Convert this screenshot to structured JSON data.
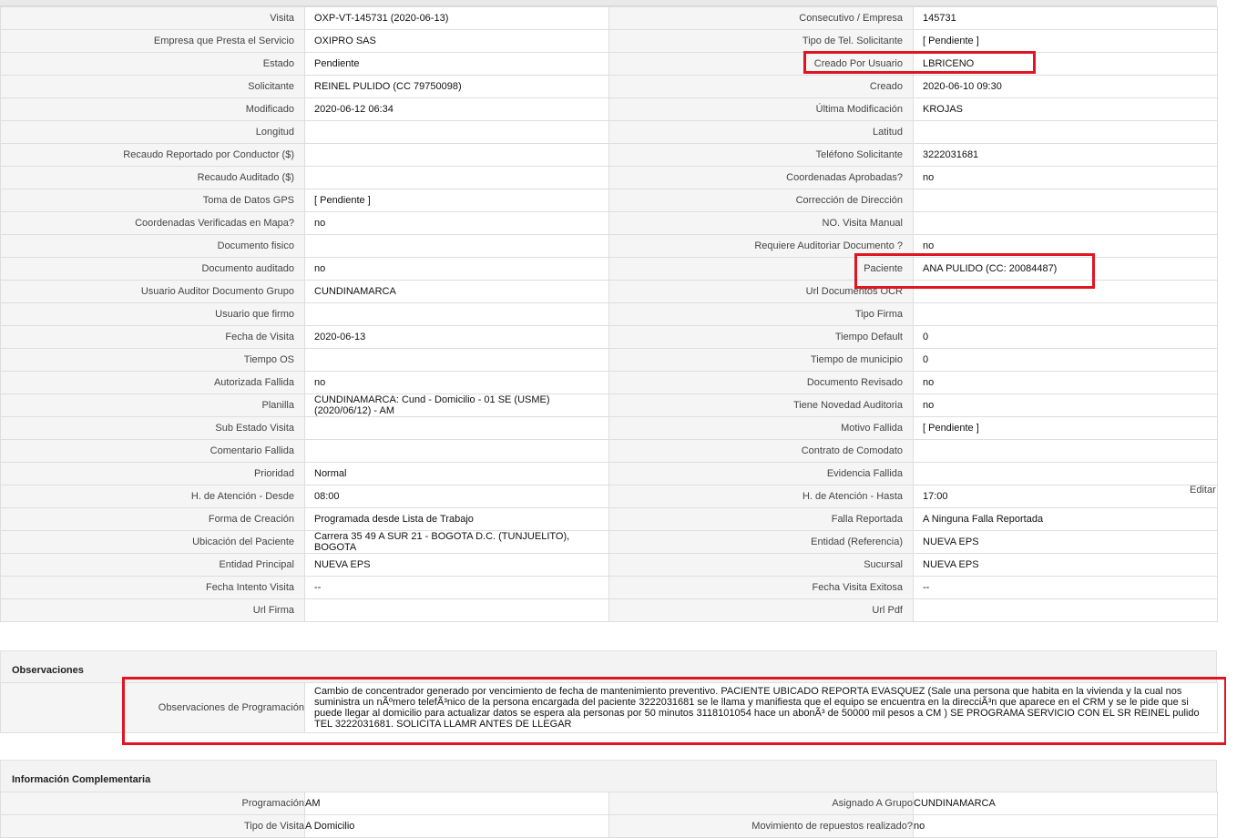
{
  "details": {
    "rows": [
      {
        "l1": "Visita",
        "v1": "OXP-VT-145731 (2020-06-13)",
        "l2": "Consecutivo / Empresa",
        "v2": "145731"
      },
      {
        "l1": "Empresa que Presta el Servicio",
        "v1": "OXIPRO SAS",
        "l2": "Tipo de Tel. Solicitante",
        "v2": "[ Pendiente ]"
      },
      {
        "l1": "Estado",
        "v1": "Pendiente",
        "l2": "Creado Por Usuario",
        "v2": "LBRICENO"
      },
      {
        "l1": "Solicitante",
        "v1": "REINEL PULIDO (CC 79750098)",
        "l2": "Creado",
        "v2": "2020-06-10 09:30"
      },
      {
        "l1": "Modificado",
        "v1": "2020-06-12 06:34",
        "l2": "Última Modificación",
        "v2": " KROJAS"
      },
      {
        "l1": "Longitud",
        "v1": "",
        "l2": "Latitud",
        "v2": ""
      },
      {
        "l1": "Recaudo Reportado por Conductor ($)",
        "v1": "",
        "l2": "Teléfono Solicitante",
        "v2": "3222031681"
      },
      {
        "l1": "Recaudo Auditado ($)",
        "v1": "",
        "l2": "Coordenadas Aprobadas?",
        "v2": " no"
      },
      {
        "l1": "Toma de Datos GPS",
        "v1": "[ Pendiente ]",
        "l2": "Corrección de Dirección",
        "v2": ""
      },
      {
        "l1": "Coordenadas Verificadas en Mapa?",
        "v1": " no",
        "l2": "NO. Visita Manual",
        "v2": ""
      },
      {
        "l1": "Documento fisico",
        "v1": "",
        "l2": "Requiere Auditoriar Documento ?",
        "v2": " no"
      },
      {
        "l1": "Documento auditado",
        "v1": " no",
        "l2": "Paciente",
        "v2": "ANA PULIDO (CC: 20084487)"
      },
      {
        "l1": "Usuario Auditor Documento Grupo",
        "v1": "CUNDINAMARCA",
        "l2": "Url Documentos OCR",
        "v2": ""
      },
      {
        "l1": "Usuario que firmo",
        "v1": "",
        "l2": "Tipo Firma",
        "v2": ""
      },
      {
        "l1": "Fecha de Visita",
        "v1": " 2020-06-13",
        "l2": "Tiempo Default",
        "v2": "0"
      },
      {
        "l1": "Tiempo OS",
        "v1": "",
        "l2": "Tiempo de municipio",
        "v2": "0"
      },
      {
        "l1": "Autorizada Fallida",
        "v1": " no",
        "l2": "Documento Revisado",
        "v2": " no"
      },
      {
        "l1": "Planilla",
        "v1": "CUNDINAMARCA: Cund - Domicilio - 01 SE (USME) (2020/06/12) - AM",
        "l2": "Tiene Novedad Auditoria",
        "v2": " no"
      },
      {
        "l1": "Sub Estado Visita",
        "v1": "",
        "l2": "Motivo Fallida",
        "v2": "[ Pendiente ]"
      },
      {
        "l1": "Comentario Fallida",
        "v1": "",
        "l2": "Contrato de Comodato",
        "v2": ""
      },
      {
        "l1": "Prioridad",
        "v1": "Normal",
        "l2": "Evidencia Fallida",
        "v2": ""
      },
      {
        "l1": "H. de Atención - Desde",
        "v1": "08:00",
        "l2": "H. de Atención - Hasta",
        "v2": "17:00"
      },
      {
        "l1": "Forma de Creación",
        "v1": "Programada desde Lista de Trabajo",
        "l2": "Falla Reportada",
        "v2": "A Ninguna Falla Reportada"
      },
      {
        "l1": "Ubicación del Paciente",
        "v1": "Carrera 35 49 A SUR 21 - BOGOTA D.C. (TUNJUELITO), BOGOTA",
        "l2": "Entidad (Referencia)",
        "v2": "NUEVA EPS"
      },
      {
        "l1": "Entidad Principal",
        "v1": "NUEVA EPS",
        "l2": "Sucursal",
        "v2": "NUEVA EPS"
      },
      {
        "l1": "Fecha Intento Visita",
        "v1": " --",
        "l2": "Fecha Visita Exitosa",
        "v2": " --"
      },
      {
        "l1": "Url Firma",
        "v1": "",
        "l2": "Url Pdf",
        "v2": ""
      }
    ],
    "edit_label": "Editar"
  },
  "observaciones": {
    "title": "Observaciones",
    "label": "Observaciones de Programación",
    "text": "   Cambio de concentrador generado por vencimiento de fecha de mantenimiento preventivo. PACIENTE UBICADO REPORTA EVASQUEZ (Sale una persona que habita en la vivienda y la cual nos suministra un nÃºmero telefÃ³nico de la persona encargada del paciente 3222031681 se le llama y manifiesta que el equipo se encuentra en la direcciÃ³n que aparece en el CRM y se le pide que si puede llegar al domicilio para actualizar datos se espera ala personas por 50 minutos 3118101054 hace un abonÃ³ de 50000 mil pesos a CM ) SE PROGRAMA SERVICIO CON EL SR REINEL pulido TEL 3222031681. SOLICITA LLAMR ANTES DE LLEGAR"
  },
  "info_complementaria": {
    "title": "Información Complementaria",
    "rows": [
      {
        "l1": "Programación",
        "v1": "AM",
        "l2": "Asignado A Grupo",
        "v2": "CUNDINAMARCA"
      },
      {
        "l1": "Tipo de Visita",
        "v1": "A Domicilio",
        "l2": "Movimiento de repuestos realizado?",
        "v2": " no"
      }
    ]
  },
  "colors": {
    "highlight": "#e01522",
    "label_bg": "#f5f5f5",
    "border": "#dedede"
  }
}
